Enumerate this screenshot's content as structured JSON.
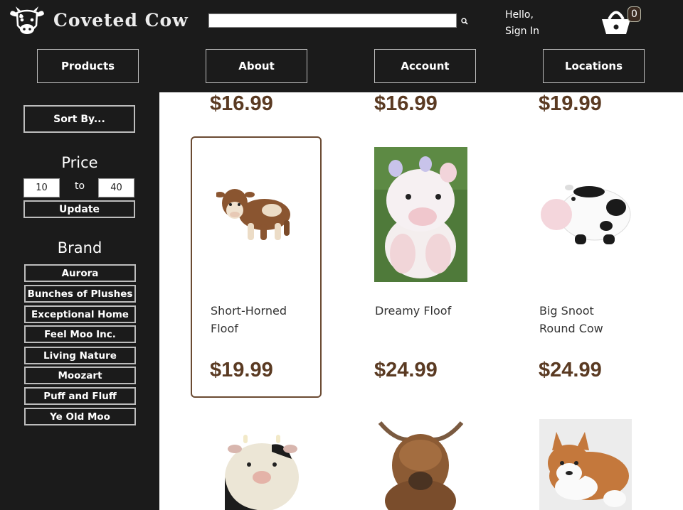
{
  "header": {
    "brand": "Coveted Cow",
    "search": {
      "value": "",
      "placeholder": ""
    },
    "greeting": {
      "hello": "Hello,",
      "sign_in": "Sign In"
    },
    "cart_count": "0",
    "nav": [
      "Products",
      "About",
      "Account",
      "Locations"
    ]
  },
  "sidebar": {
    "sort_label": "Sort By...",
    "price_title": "Price",
    "price_min": "10",
    "price_to": "to",
    "price_max": "40",
    "update_label": "Update",
    "brand_title": "Brand",
    "brands": [
      "Aurora",
      "Bunches of Plushes",
      "Exceptional Home",
      "Feel Moo Inc.",
      "Living Nature",
      "Moozart",
      "Puff and Fluff",
      "Ye Old Moo"
    ]
  },
  "products": {
    "top_prices": [
      "$16.99",
      "$16.99",
      "$19.99"
    ],
    "items": [
      {
        "name_line1": "Short-Horned",
        "name_line2": "Floof",
        "price": "$19.99"
      },
      {
        "name_line1": "Dreamy Floof",
        "name_line2": "",
        "price": "$24.99"
      },
      {
        "name_line1": "Big Snoot",
        "name_line2": "Round Cow",
        "price": "$24.99"
      }
    ]
  },
  "colors": {
    "background": "#1b1b1b",
    "price": "#5a3a22",
    "card_border": "#6a4a32"
  }
}
